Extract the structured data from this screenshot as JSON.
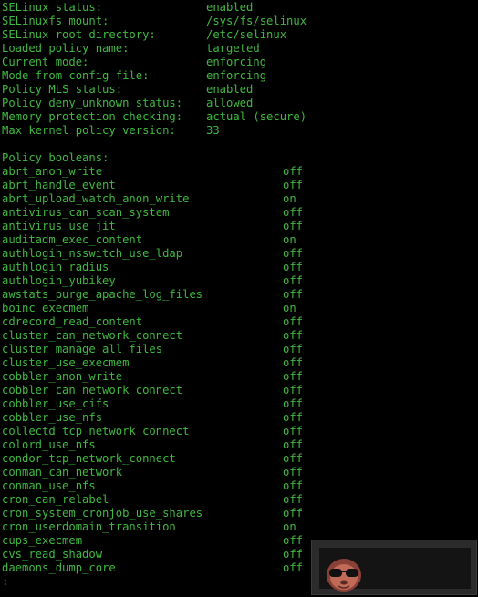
{
  "status": [
    {
      "key": "SELinux status:",
      "value": "enabled"
    },
    {
      "key": "SELinuxfs mount:",
      "value": "/sys/fs/selinux"
    },
    {
      "key": "SELinux root directory:",
      "value": "/etc/selinux"
    },
    {
      "key": "Loaded policy name:",
      "value": "targeted"
    },
    {
      "key": "Current mode:",
      "value": "enforcing"
    },
    {
      "key": "Mode from config file:",
      "value": "enforcing"
    },
    {
      "key": "Policy MLS status:",
      "value": "enabled"
    },
    {
      "key": "Policy deny_unknown status:",
      "value": "allowed"
    },
    {
      "key": "Memory protection checking:",
      "value": "actual (secure)"
    },
    {
      "key": "Max kernel policy version:",
      "value": "33"
    }
  ],
  "booleans_header": "Policy booleans:",
  "booleans": [
    {
      "name": "abrt_anon_write",
      "value": "off"
    },
    {
      "name": "abrt_handle_event",
      "value": "off"
    },
    {
      "name": "abrt_upload_watch_anon_write",
      "value": "on"
    },
    {
      "name": "antivirus_can_scan_system",
      "value": "off"
    },
    {
      "name": "antivirus_use_jit",
      "value": "off"
    },
    {
      "name": "auditadm_exec_content",
      "value": "on"
    },
    {
      "name": "authlogin_nsswitch_use_ldap",
      "value": "off"
    },
    {
      "name": "authlogin_radius",
      "value": "off"
    },
    {
      "name": "authlogin_yubikey",
      "value": "off"
    },
    {
      "name": "awstats_purge_apache_log_files",
      "value": "off"
    },
    {
      "name": "boinc_execmem",
      "value": "on"
    },
    {
      "name": "cdrecord_read_content",
      "value": "off"
    },
    {
      "name": "cluster_can_network_connect",
      "value": "off"
    },
    {
      "name": "cluster_manage_all_files",
      "value": "off"
    },
    {
      "name": "cluster_use_execmem",
      "value": "off"
    },
    {
      "name": "cobbler_anon_write",
      "value": "off"
    },
    {
      "name": "cobbler_can_network_connect",
      "value": "off"
    },
    {
      "name": "cobbler_use_cifs",
      "value": "off"
    },
    {
      "name": "cobbler_use_nfs",
      "value": "off"
    },
    {
      "name": "collectd_tcp_network_connect",
      "value": "off"
    },
    {
      "name": "colord_use_nfs",
      "value": "off"
    },
    {
      "name": "condor_tcp_network_connect",
      "value": "off"
    },
    {
      "name": "conman_can_network",
      "value": "off"
    },
    {
      "name": "conman_use_nfs",
      "value": "off"
    },
    {
      "name": "cron_can_relabel",
      "value": "off"
    },
    {
      "name": "cron_system_cronjob_use_shares",
      "value": "off"
    },
    {
      "name": "cron_userdomain_transition",
      "value": "on"
    },
    {
      "name": "cups_execmem",
      "value": "off"
    },
    {
      "name": "cvs_read_shadow",
      "value": "off"
    },
    {
      "name": "daemons_dump_core",
      "value": "off"
    }
  ],
  "pager_prompt": ":",
  "overlay": {
    "icon": "sloth-sunglasses-icon",
    "colors": {
      "face": "#b85a4a",
      "glasses": "#111111",
      "panel": "#2b2b2b"
    }
  },
  "colors": {
    "text": "#3fb93f",
    "background": "#000000"
  }
}
